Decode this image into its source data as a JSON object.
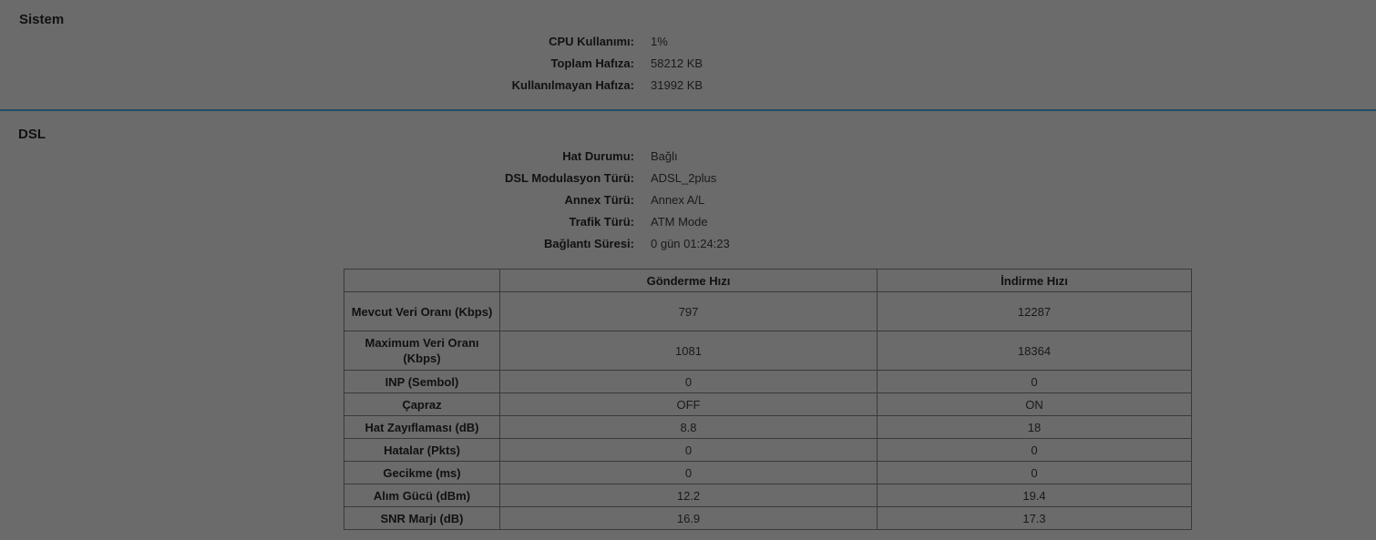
{
  "sistem": {
    "title": "Sistem",
    "rows": [
      {
        "label": "CPU Kullanımı:",
        "value": "1%"
      },
      {
        "label": "Toplam Hafıza:",
        "value": "58212 KB"
      },
      {
        "label": "Kullanılmayan Hafıza:",
        "value": "31992 KB"
      }
    ]
  },
  "dsl": {
    "title": "DSL",
    "rows": [
      {
        "label": "Hat Durumu:",
        "value": "Bağlı"
      },
      {
        "label": "DSL Modulasyon Türü:",
        "value": "ADSL_2plus"
      },
      {
        "label": "Annex Türü:",
        "value": "Annex A/L"
      },
      {
        "label": "Trafik Türü:",
        "value": "ATM Mode"
      },
      {
        "label": "Bağlantı Süresi:",
        "value": "0 gün 01:24:23"
      }
    ],
    "table": {
      "headers": [
        "",
        "Gönderme Hızı",
        "İndirme Hızı"
      ],
      "rows": [
        {
          "label": "Mevcut Veri Oranı (Kbps)",
          "up": "797",
          "down": "12287"
        },
        {
          "label": "Maximum Veri Oranı (Kbps)",
          "up": "1081",
          "down": "18364"
        },
        {
          "label": "INP (Sembol)",
          "up": "0",
          "down": "0"
        },
        {
          "label": "Çapraz",
          "up": "OFF",
          "down": "ON"
        },
        {
          "label": "Hat Zayıflaması (dB)",
          "up": "8.8",
          "down": "18"
        },
        {
          "label": "Hatalar (Pkts)",
          "up": "0",
          "down": "0"
        },
        {
          "label": "Gecikme (ms)",
          "up": "0",
          "down": "0"
        },
        {
          "label": "Alım Gücü (dBm)",
          "up": "12.2",
          "down": "19.4"
        },
        {
          "label": "SNR Marjı (dB)",
          "up": "16.9",
          "down": "17.3"
        }
      ]
    }
  }
}
